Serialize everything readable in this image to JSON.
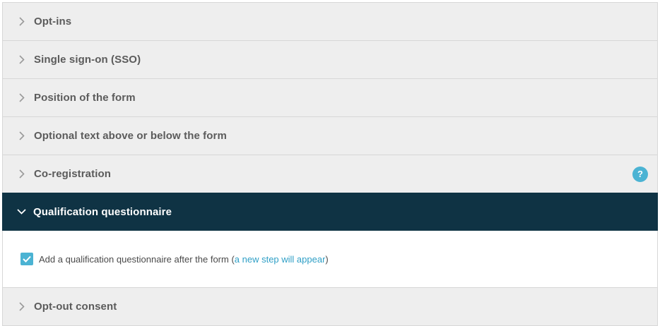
{
  "accordion": {
    "panels": [
      {
        "title": "Opt-ins"
      },
      {
        "title": "Single sign-on (SSO)"
      },
      {
        "title": "Position of the form"
      },
      {
        "title": "Optional text above or below the form"
      },
      {
        "title": "Co-registration",
        "help": "?"
      },
      {
        "title": "Qualification questionnaire"
      },
      {
        "title": "Opt-out consent"
      }
    ],
    "open_panel": {
      "checkbox_checked": true,
      "text_before": "Add a qualification questionnaire after the form (",
      "link_text": "a new step will appear",
      "text_after": ")"
    }
  },
  "colors": {
    "active_header": "#0f3344",
    "accent": "#4bb3d3",
    "panel_bg": "#eeeeee"
  },
  "icons": {
    "collapsed": "chevron-right-icon",
    "expanded": "chevron-down-icon",
    "help": "help-icon",
    "check": "checkmark-icon"
  }
}
